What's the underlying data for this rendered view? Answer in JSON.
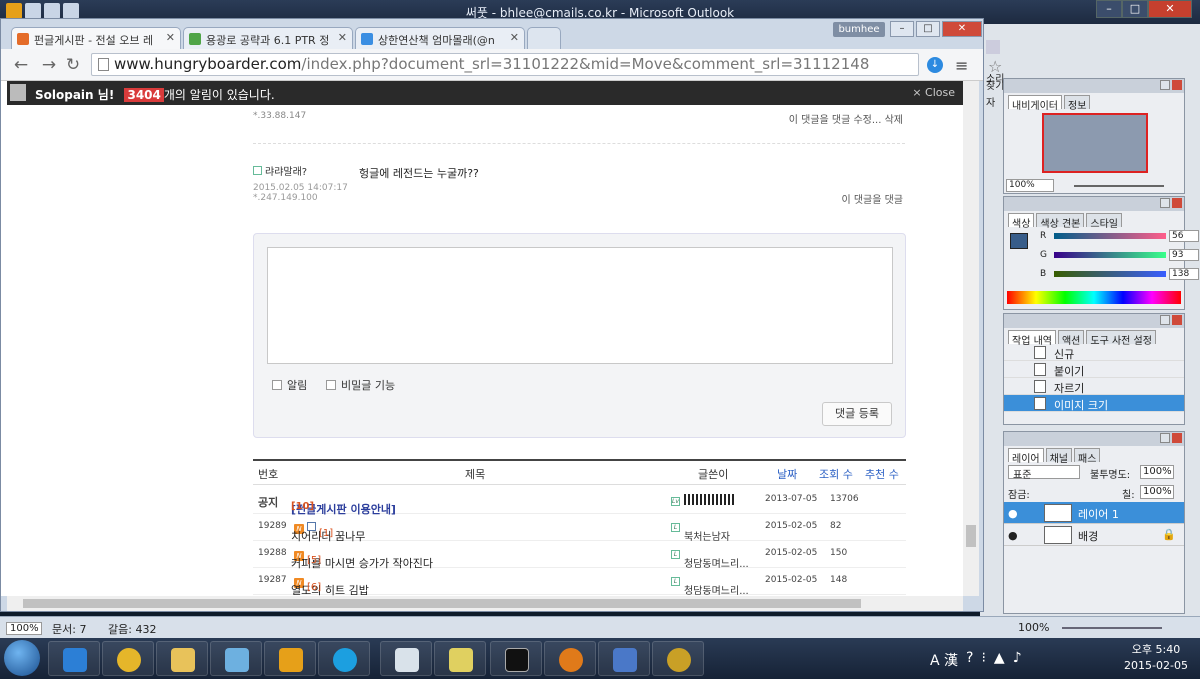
{
  "outlook": {
    "title": "써풋 - bhlee@cmails.co.kr - Microsoft Outlook",
    "status_zoom": "100%",
    "status_doc": "문서: 7",
    "status_count": "갈음: 432",
    "status_zoom_right": "100%",
    "find_label": "찾기",
    "side_text_1": "소리",
    "side_text_2": "자"
  },
  "chrome": {
    "user_badge": "bumhee",
    "tabs": [
      {
        "label": "펀글게시판 - 전설 오브 레",
        "color": "#e46c2a"
      },
      {
        "label": "용광로 공략과 6.1 PTR 정",
        "color": "#4fa447"
      },
      {
        "label": "상한연산책 엄마몰래(@n",
        "color": "#3a8ee2"
      }
    ],
    "url_host": "www.hungryboarder.com",
    "url_rest": "/index.php?document_srl=31101222&mid=Move&comment_srl=31112148"
  },
  "notification": {
    "user": "Solopain",
    "suffix1": "님!",
    "count": "3404",
    "suffix2": "개의 알림이 있습니다.",
    "close": "× Close"
  },
  "comments": [
    {
      "ip": "*.33.88.147",
      "actions": "이 댓글을   댓글   수정...   삭제"
    },
    {
      "nick": "랴랴말래?",
      "text": "헝글에 레전드는 누굴까??",
      "date": "2015.02.05 14:07:17",
      "ip": "*.247.149.100",
      "actions": "이 댓글을   댓글"
    }
  ],
  "comment_form": {
    "alarm": "알림",
    "secret": "비밀글 기능",
    "submit": "댓글 등록"
  },
  "table": {
    "headers": {
      "no": "번호",
      "title": "제목",
      "author": "글쓴이",
      "date": "날짜",
      "views": "조회 수",
      "likes": "추천 수"
    },
    "rows": [
      {
        "no": "공지",
        "title": "[펀글게시판 이용안내]",
        "comments": "[10]",
        "author": "",
        "date": "2013-07-05",
        "views": "13706",
        "notice": true,
        "new": false
      },
      {
        "no": "19289",
        "title": "치어리더 꿈나무",
        "comments": "[1]",
        "author": "북처는남자",
        "date": "2015-02-05",
        "views": "82",
        "notice": false,
        "new": true
      },
      {
        "no": "19288",
        "title": "커피를 마시면 승가가 작아진다",
        "comments": "[5]",
        "author": "청담동며느리...",
        "date": "2015-02-05",
        "views": "150",
        "notice": false,
        "new": true
      },
      {
        "no": "19287",
        "title": "열도의 히트 김밥",
        "comments": "[6]",
        "author": "청담동며느리...",
        "date": "2015-02-05",
        "views": "148",
        "notice": false,
        "new": true
      }
    ]
  },
  "photoshop": {
    "navigator": {
      "tabs": [
        "내비게이터",
        "정보"
      ],
      "zoom": "100%"
    },
    "color": {
      "tabs": [
        "색상",
        "색상 견본",
        "스타일"
      ],
      "r_label": "R",
      "r": "56",
      "g_label": "G",
      "g": "93",
      "b_label": "B",
      "b": "138",
      "swatch": "#385d8a"
    },
    "history": {
      "tabs": [
        "작업 내역",
        "액션",
        "도구 사전 설정"
      ],
      "items": [
        "신규",
        "붙이기",
        "자르기",
        "이미지 크기"
      ]
    },
    "layers": {
      "tabs": [
        "레이어",
        "채널",
        "패스"
      ],
      "blend": "표준",
      "opacity_label": "불투명도:",
      "opacity": "100%",
      "lock_label": "잠금:",
      "fill_label": "칠:",
      "fill": "100%",
      "items": [
        "레이어 1",
        "배경"
      ]
    }
  },
  "taskbar": {
    "time": "오후 5:40",
    "date": "2015-02-05",
    "ime": "A 漢",
    "apps": [
      "ie",
      "chrome",
      "explorer",
      "notebook",
      "outlook",
      "skype",
      "ezhelp",
      "dbf",
      "cmd",
      "media",
      "visual-studio",
      "wow"
    ]
  }
}
